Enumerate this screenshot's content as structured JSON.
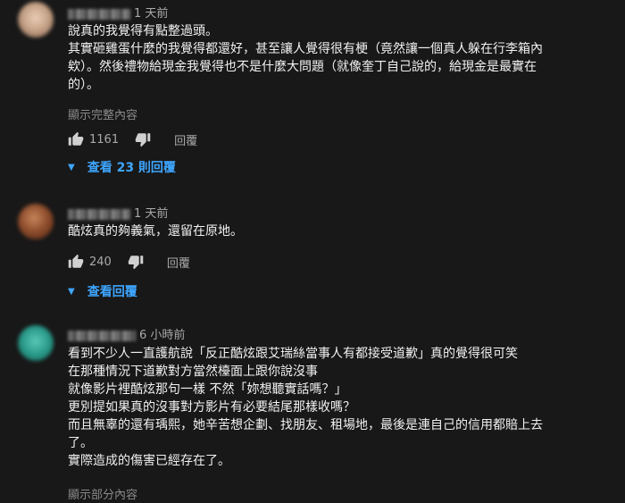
{
  "comments": [
    {
      "time": "1 天前",
      "avatar_color": "#c8a58a",
      "lines": [
        "說真的我覺得有點整過頭。",
        "其實砸雞蛋什麼的我覺得都還好，甚至讓人覺得很有梗（竟然讓一個真人躲在行李箱內",
        "欸）。然後禮物給現金我覺得也不是什麼大問題（就像奎丁自己說的，給現金是最實在",
        "的）。"
      ],
      "show_more": "顯示完整內容",
      "likes": "1161",
      "reply_label": "回覆",
      "replies_label": "查看 23 則回覆"
    },
    {
      "time": "1 天前",
      "avatar_color": "#8a4a2a",
      "lines": [
        "酷炫真的夠義氣，還留在原地。"
      ],
      "likes": "240",
      "reply_label": "回覆",
      "replies_label": "查看回覆"
    },
    {
      "time": "6 小時前",
      "avatar_color": "#2a9a8a",
      "lines": [
        "看到不少人一直護航說「反正酷炫跟艾瑞絲當事人有都接受道歉」真的覺得很可笑",
        "在那種情況下道歉對方當然檯面上跟你說沒事",
        "就像影片裡酷炫那句一樣 不然「妳想聽實話嗎？」",
        "更別提如果真的沒事對方影片有必要結尾那樣收嗎？",
        "而且無辜的還有瑀熙，她辛苦想企劃、找朋友、租場地，最後是連自己的信用都賠上去",
        "了。",
        "實際造成的傷害已經存在了。"
      ],
      "show_more": "顯示部分內容"
    }
  ]
}
